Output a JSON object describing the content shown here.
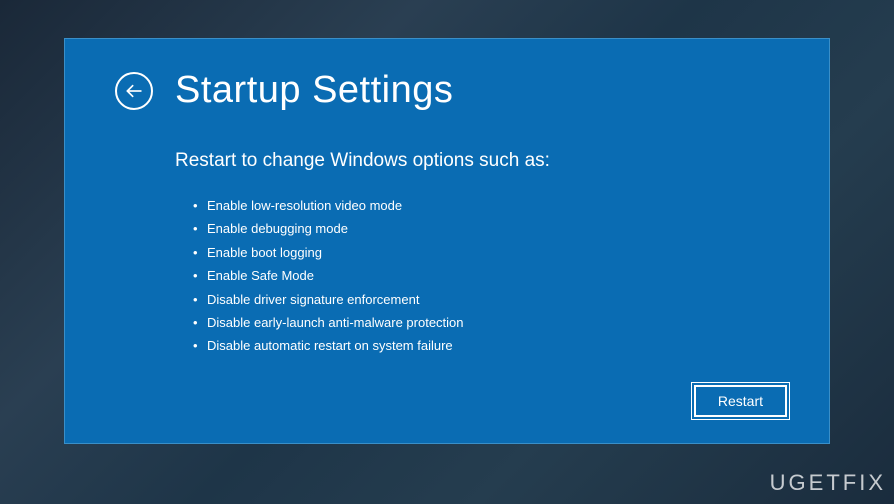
{
  "header": {
    "title": "Startup Settings"
  },
  "content": {
    "subtitle": "Restart to change Windows options such as:",
    "options": [
      "Enable low-resolution video mode",
      "Enable debugging mode",
      "Enable boot logging",
      "Enable Safe Mode",
      "Disable driver signature enforcement",
      "Disable early-launch anti-malware protection",
      "Disable automatic restart on system failure"
    ]
  },
  "actions": {
    "restart_label": "Restart"
  },
  "watermark": "UGETFIX"
}
